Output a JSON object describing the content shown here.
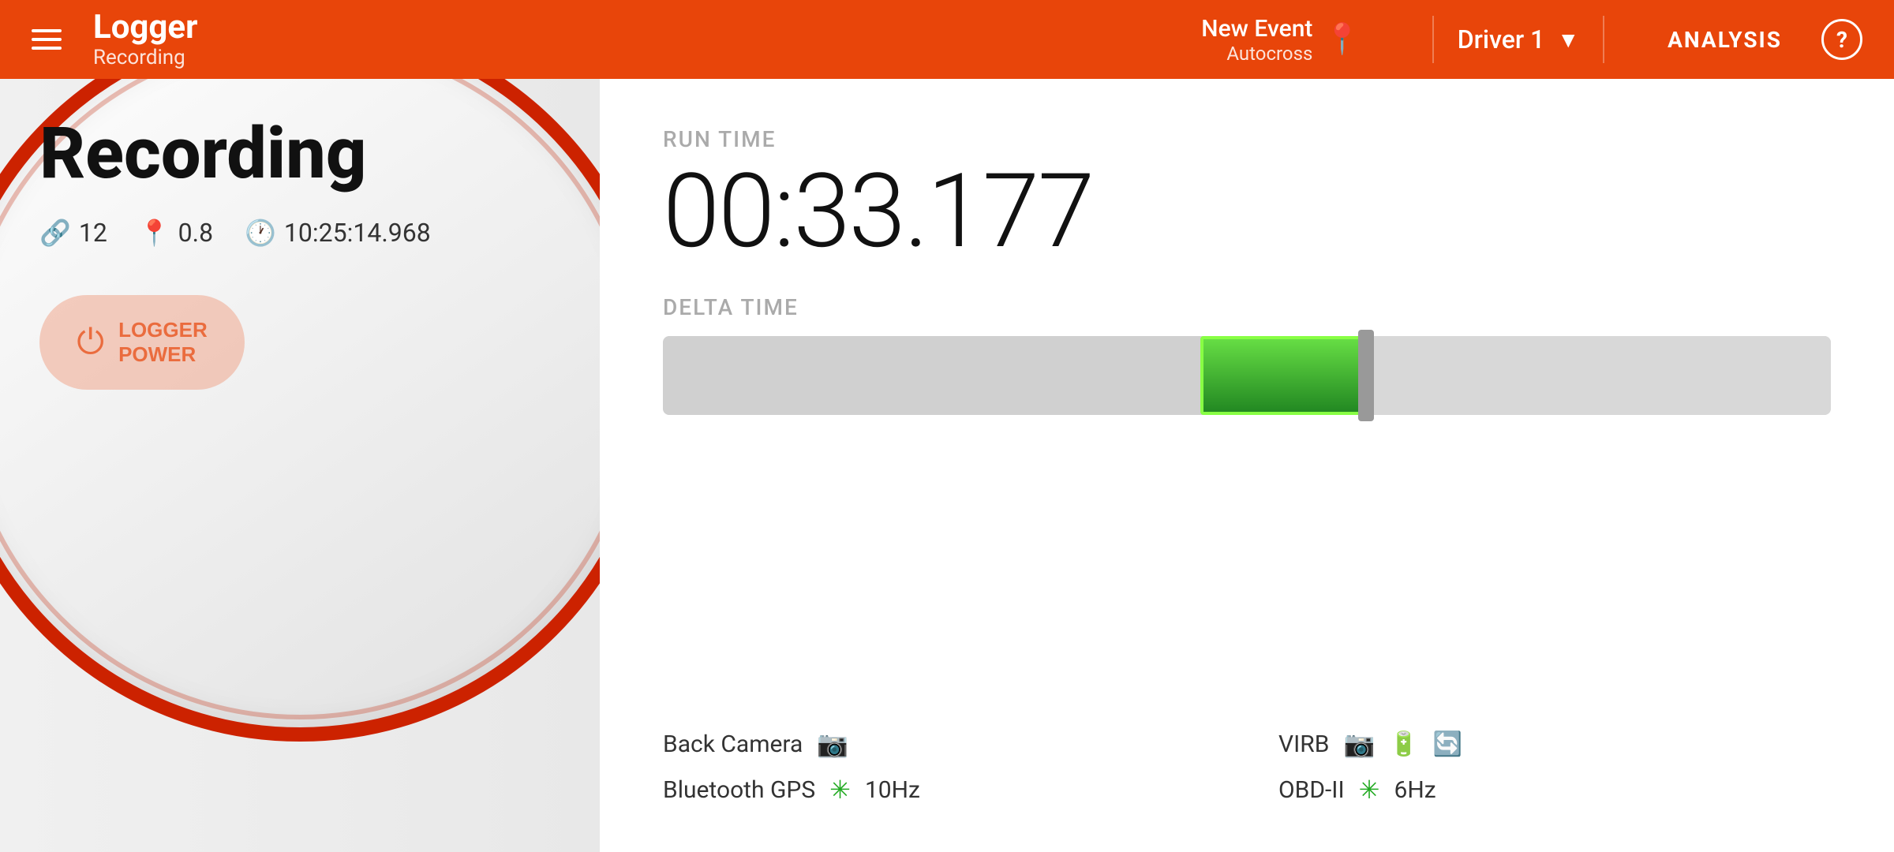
{
  "header": {
    "menu_label": "Menu",
    "app_title": "Logger",
    "app_subtitle": "Recording",
    "event_name": "New Event",
    "event_type": "Autocross",
    "driver_name": "Driver 1",
    "analysis_label": "ANALYSIS",
    "help_label": "?"
  },
  "main": {
    "recording_title": "Recording",
    "stats": {
      "signal_count": "12",
      "distance": "0.8",
      "time": "10:25:14.968"
    },
    "logger_power_label": "LOGGER\nPOWER",
    "run_time_label": "RUN TIME",
    "run_time_value": "00:33.177",
    "delta_time_label": "DELTA TIME",
    "status_items": [
      {
        "label": "Back Camera",
        "icon": "camera",
        "color": "red"
      },
      {
        "label": "Bluetooth GPS",
        "icon": "bluetooth",
        "color": "green",
        "extra": "10Hz"
      },
      {
        "label": "VIRB",
        "icon": "camera",
        "color": "red",
        "extra": ""
      },
      {
        "label": "OBD-II",
        "icon": "bluetooth",
        "color": "green",
        "extra": "6Hz"
      }
    ]
  }
}
